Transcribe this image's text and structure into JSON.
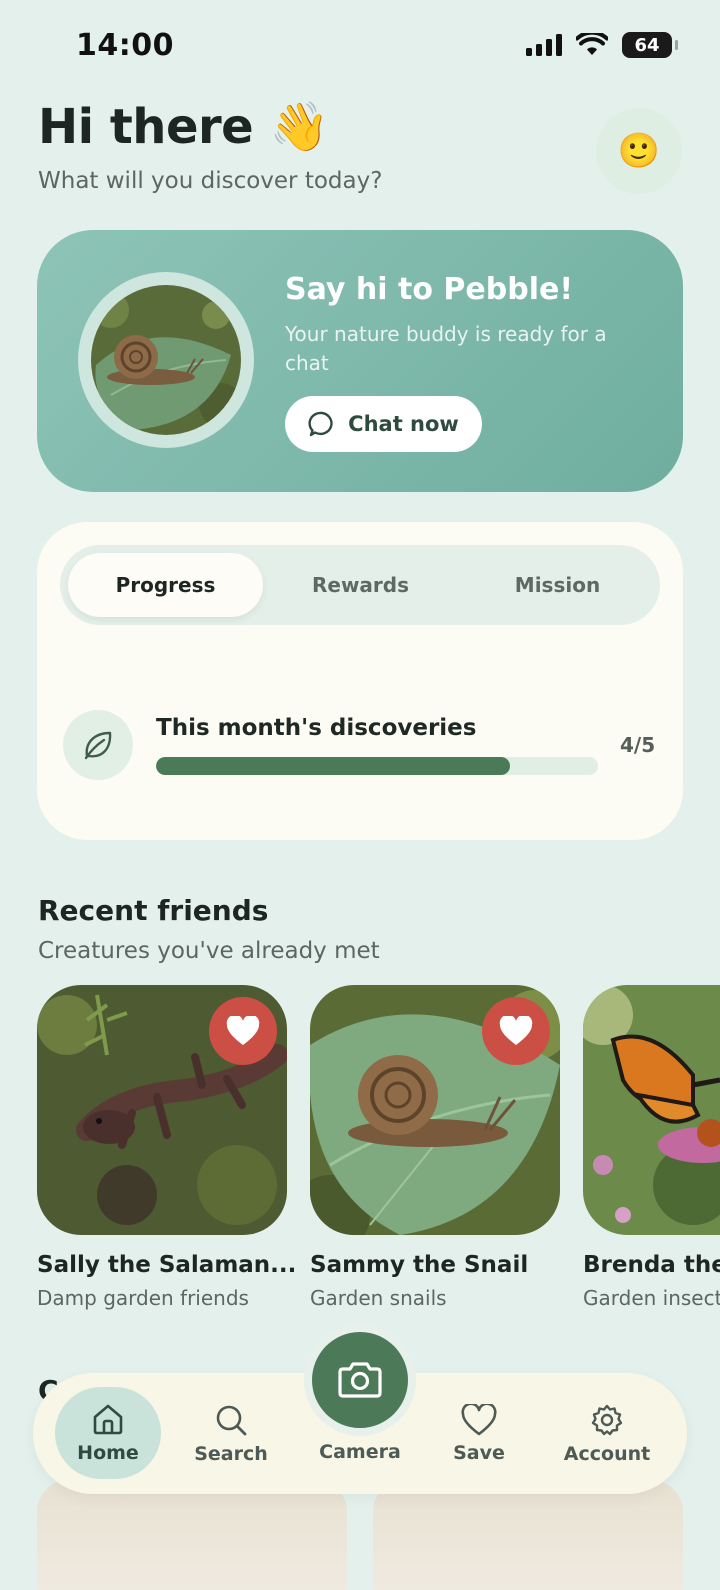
{
  "status_bar": {
    "time": "14:00",
    "battery": "64"
  },
  "greeting": {
    "title": "Hi there 👋",
    "subtitle": "What will you discover today?",
    "avatar_emoji": "🙂"
  },
  "pebble": {
    "title": "Say hi to Pebble!",
    "description": "Your nature buddy is ready for a chat",
    "chat_label": "Chat now"
  },
  "tabs": [
    {
      "label": "Progress",
      "active": true
    },
    {
      "label": "Rewards",
      "active": false
    },
    {
      "label": "Mission",
      "active": false
    }
  ],
  "discoveries": {
    "title": "This month's discoveries",
    "count": "4/5",
    "fraction": 0.8
  },
  "recent_friends": {
    "title": "Recent friends",
    "subtitle": "Creatures you've already met",
    "items": [
      {
        "name": "Sally the Salaman...",
        "subtitle": "Damp garden friends",
        "favorited": true
      },
      {
        "name": "Sammy the Snail",
        "subtitle": "Garden snails",
        "favorited": true
      },
      {
        "name": "Brenda the",
        "subtitle": "Garden insects",
        "favorited": false
      }
    ]
  },
  "next_section": {
    "title_partial": "C"
  },
  "nav": {
    "home": "Home",
    "search": "Search",
    "camera": "Camera",
    "save": "Save",
    "account": "Account"
  },
  "colors": {
    "background": "#e4f0eb",
    "accent_green": "#4c7a59",
    "heart_red": "#cc4f45",
    "pebble_card": "#7fb8aa"
  }
}
